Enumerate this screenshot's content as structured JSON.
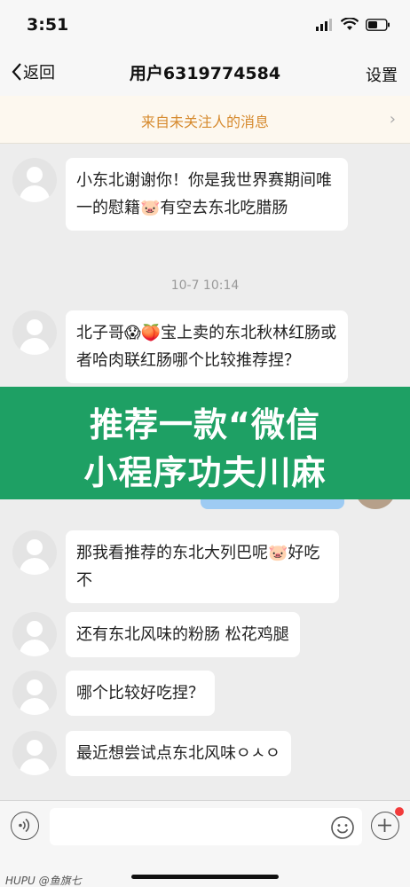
{
  "status_bar": {
    "time": "3:51"
  },
  "nav": {
    "back_label": "返回",
    "title": "用户6319774584",
    "settings_label": "设置"
  },
  "notice": {
    "text": "来自未关注人的消息"
  },
  "messages": [
    {
      "text": "小东北谢谢你！你是我世界赛期间唯一的慰籍🐷有空去东北吃腊肠"
    },
    {
      "text": "北子哥😱🍑宝上卖的东北秋林红肠或者哈肉联红肠哪个比较推荐捏？"
    },
    {
      "text": "那我看推荐的东北大列巴呢🐷好吃不"
    },
    {
      "text": "还有东北风味的粉肠 松花鸡腿"
    },
    {
      "text": "哪个比较好吃捏？"
    },
    {
      "text": "最近想尝试点东北风味ㅇㅅㅇ"
    }
  ],
  "timestamp": "10-7 10:14",
  "banner": {
    "line1": "推荐一款“微信",
    "line2": "小程序功夫川麻"
  },
  "watermark": "HUPU @鱼旗七"
}
